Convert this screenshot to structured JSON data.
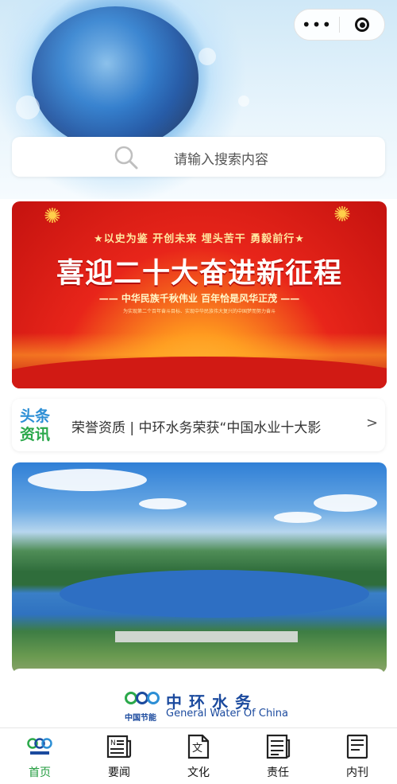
{
  "capsule": {
    "more_glyph": "•••",
    "more_icon": "more-dots-icon",
    "close_icon": "target-circle-icon"
  },
  "search": {
    "placeholder": "请输入搜索内容",
    "icon": "search-icon"
  },
  "banner": {
    "slogan_top": "★以史为鉴  开创未来  埋头苦干  勇毅前行★",
    "title": "喜迎二十大奋进新征程",
    "subtitle": "—— 中华民族千秋伟业  百年恰是风华正茂 ——",
    "tiny": "为实现第二个百年奋斗目标、实现中华民族伟大复兴的中国梦而努力奋斗"
  },
  "news": {
    "badge_line1": "头条",
    "badge_line2": "资讯",
    "text": "荣誉资质 | 中环水务荣获“中国水业十大影",
    "arrow": ">"
  },
  "logo": {
    "cn_small": "中国节能",
    "cn_big": "中环水务",
    "en": "General Water Of China"
  },
  "tabs": [
    {
      "label": "首页",
      "icon": "cecep-logo-icon",
      "active": true
    },
    {
      "label": "要闻",
      "icon": "newspaper-icon",
      "active": false
    },
    {
      "label": "文化",
      "icon": "document-text-icon",
      "active": false
    },
    {
      "label": "责任",
      "icon": "list-document-icon",
      "active": false
    },
    {
      "label": "内刊",
      "icon": "journal-icon",
      "active": false
    }
  ],
  "colors": {
    "active_tab": "#1f9a3c",
    "brand_blue": "#1b4a9e",
    "banner_red": "#d11a14"
  }
}
